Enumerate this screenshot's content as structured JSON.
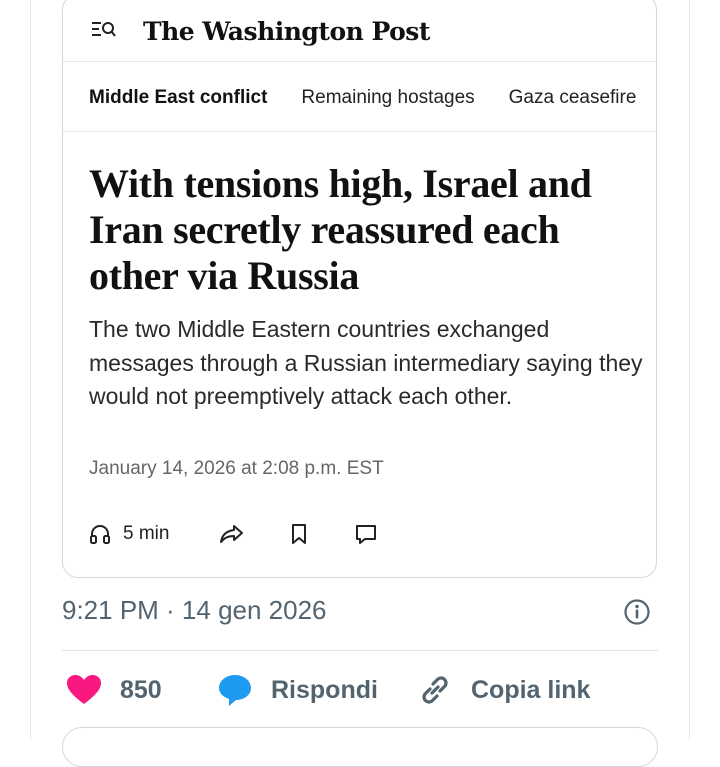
{
  "article_card": {
    "publisher": "The Washington Post",
    "nav_tabs": [
      {
        "label": "Middle East conflict"
      },
      {
        "label": "Remaining hostages"
      },
      {
        "label": "Gaza ceasefire"
      }
    ],
    "headline": "With tensions high, Israel and Iran secretly reassured each other via Russia",
    "summary": "The two Middle Eastern countries exchanged messages through a Russian intermediary saying they would not preemptively attack each other.",
    "timestamp": "January 14, 2026 at 2:08 p.m. EST",
    "listen_time": "5 min"
  },
  "tweet": {
    "posted_at": "9:21 PM · 14 gen 2026",
    "like_count": "850",
    "reply_label": "Rispondi",
    "copy_link_label": "Copia link"
  },
  "colors": {
    "like": "#f91880",
    "reply": "#1d9bf0",
    "muted_text": "#536471"
  }
}
